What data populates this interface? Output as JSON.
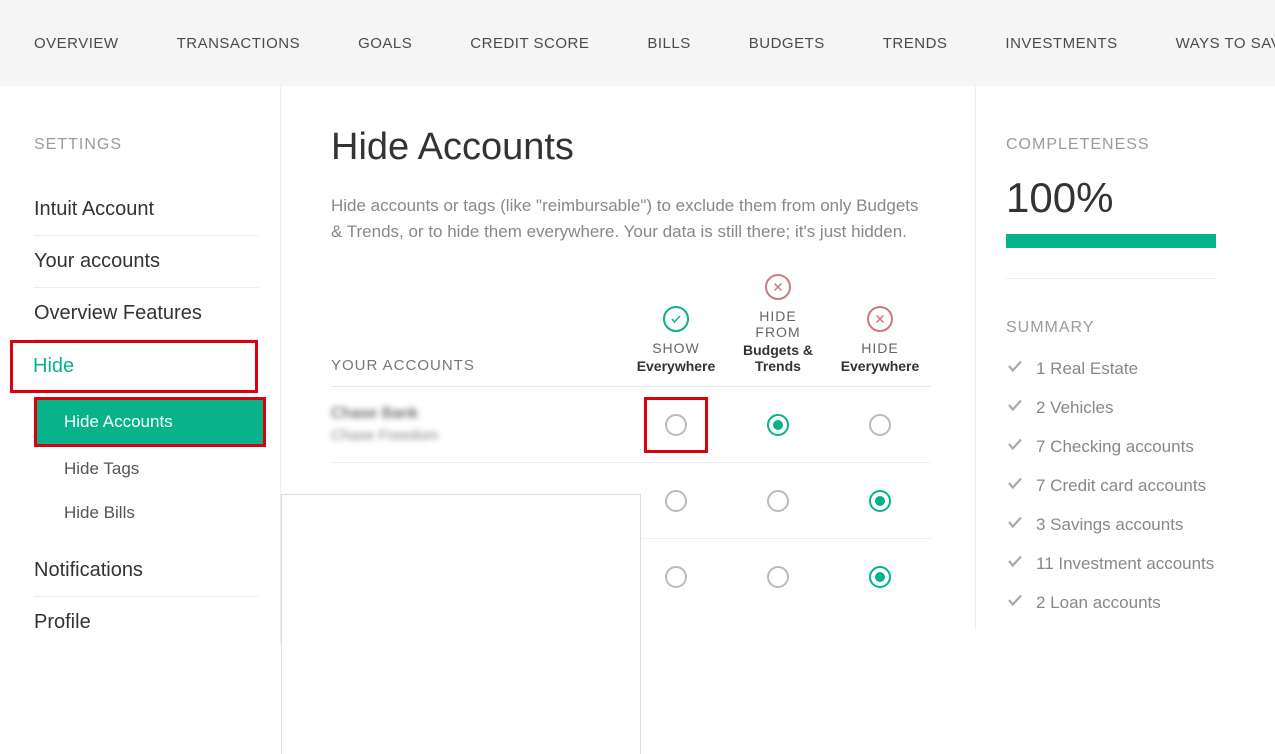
{
  "topnav": [
    "OVERVIEW",
    "TRANSACTIONS",
    "GOALS",
    "CREDIT SCORE",
    "BILLS",
    "BUDGETS",
    "TRENDS",
    "INVESTMENTS",
    "WAYS TO SAVE"
  ],
  "sidebar": {
    "heading": "SETTINGS",
    "items": [
      "Intuit Account",
      "Your accounts",
      "Overview Features",
      "Hide",
      "Notifications",
      "Profile"
    ],
    "hide_sub": [
      "Hide Accounts",
      "Hide Tags",
      "Hide Bills"
    ]
  },
  "main": {
    "title": "Hide Accounts",
    "desc": "Hide accounts or tags (like \"reimbursable\") to exclude them from only Budgets & Trends, or to hide them everywhere. Your data is still there; it's just hidden.",
    "accounts_header": "YOUR ACCOUNTS",
    "cols": {
      "show": {
        "l1": "SHOW",
        "l2": "Everywhere"
      },
      "hidebt": {
        "l1": "HIDE",
        "l2": "FROM",
        "l3": "Budgets & Trends"
      },
      "hideall": {
        "l1": "HIDE",
        "l2": "Everywhere"
      }
    },
    "rows": [
      {
        "bank": "Chase Bank",
        "sub": "Chase Freedom",
        "selected": 1
      },
      {
        "bank": "",
        "sub": "",
        "selected": 2
      },
      {
        "bank": "",
        "sub": "",
        "selected": 2
      }
    ]
  },
  "right": {
    "completeness_label": "COMPLETENESS",
    "pct": "100%",
    "summary_label": "SUMMARY",
    "summary": [
      "1 Real Estate",
      "2 Vehicles",
      "7 Checking accounts",
      "7 Credit card accounts",
      "3 Savings accounts",
      "11 Investment accounts",
      "2 Loan accounts"
    ]
  }
}
